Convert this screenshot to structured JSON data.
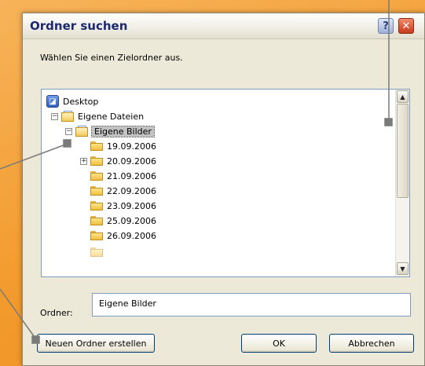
{
  "dialog": {
    "title": "Ordner suchen",
    "help_glyph": "?",
    "close_glyph": "✕",
    "instruction": "Wählen Sie einen Zielordner aus."
  },
  "tree": {
    "desktop": "Desktop",
    "my_documents": "Eigene Dateien",
    "my_pictures": "Eigene Bilder",
    "folders": [
      "19.09.2006",
      "20.09.2006",
      "21.09.2006",
      "22.09.2006",
      "23.09.2006",
      "25.09.2006",
      "26.09.2006"
    ],
    "expand_glyph_open": "−",
    "expand_glyph_closed": "+"
  },
  "folder_field": {
    "label": "Ordner:",
    "value": "Eigene Bilder"
  },
  "buttons": {
    "new_folder": "Neuen Ordner erstellen",
    "ok": "OK",
    "cancel": "Abbrechen"
  },
  "colors": {
    "background": "#f39b2e",
    "dialog": "#ece9d8",
    "title_text": "#1e2a6e"
  }
}
